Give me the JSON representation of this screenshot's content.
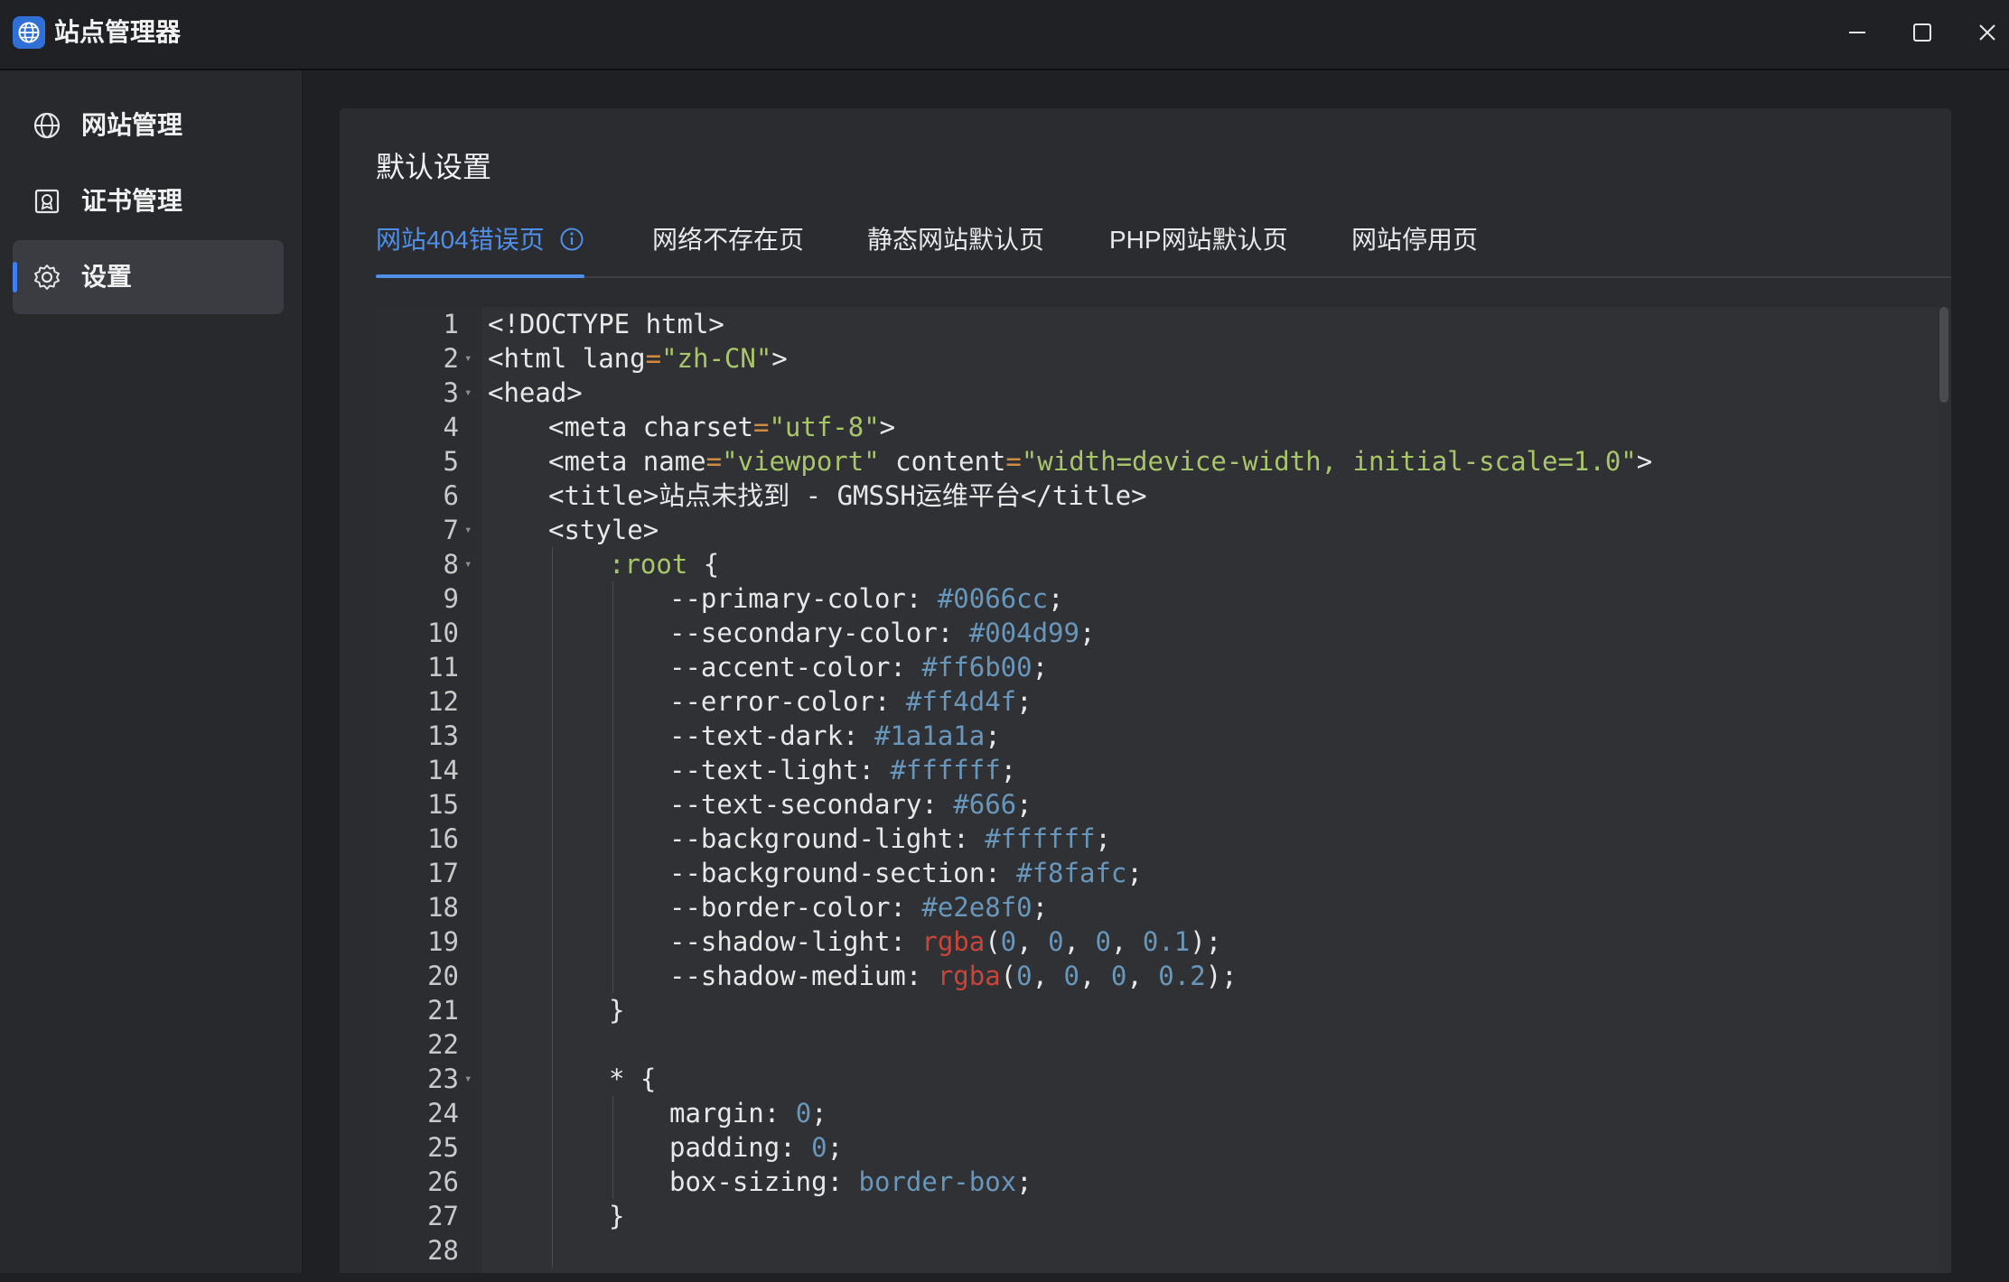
{
  "app": {
    "title": "站点管理器"
  },
  "window_controls": [
    "minimize",
    "maximize",
    "close"
  ],
  "sidebar": {
    "items": [
      {
        "label": "网站管理",
        "icon": "globe-icon",
        "active": false
      },
      {
        "label": "证书管理",
        "icon": "certificate-icon",
        "active": false
      },
      {
        "label": "设置",
        "icon": "gear-icon",
        "active": true
      }
    ]
  },
  "main": {
    "section_title": "默认设置",
    "tabs": [
      {
        "label": "网站404错误页",
        "active": true,
        "has_info_icon": true
      },
      {
        "label": "网络不存在页",
        "active": false
      },
      {
        "label": "静态网站默认页",
        "active": false
      },
      {
        "label": "PHP网站默认页",
        "active": false
      },
      {
        "label": "网站停用页",
        "active": false
      }
    ]
  },
  "colors": {
    "accent": "#4f8fe8",
    "string": "#a9c56a",
    "number": "#6897bb",
    "function": "#c8453a",
    "operator": "#cf8b3f"
  },
  "editor": {
    "lines": [
      {
        "n": "1",
        "fold": false,
        "indent": 0,
        "tokens": [
          [
            "tag",
            "<!DOCTYPE html>"
          ]
        ]
      },
      {
        "n": "2",
        "fold": true,
        "indent": 0,
        "tokens": [
          [
            "tag",
            "<html "
          ],
          [
            "attr",
            "lang"
          ],
          [
            "eq",
            "="
          ],
          [
            "str",
            "\"zh-CN\""
          ],
          [
            "tag",
            ">"
          ]
        ]
      },
      {
        "n": "3",
        "fold": true,
        "indent": 0,
        "tokens": [
          [
            "tag",
            "<head>"
          ]
        ]
      },
      {
        "n": "4",
        "fold": false,
        "indent": 1,
        "tokens": [
          [
            "tag",
            "<meta "
          ],
          [
            "attr",
            "charset"
          ],
          [
            "eq",
            "="
          ],
          [
            "str",
            "\"utf-8\""
          ],
          [
            "tag",
            ">"
          ]
        ]
      },
      {
        "n": "5",
        "fold": false,
        "indent": 1,
        "tokens": [
          [
            "tag",
            "<meta "
          ],
          [
            "attr",
            "name"
          ],
          [
            "eq",
            "="
          ],
          [
            "str",
            "\"viewport\""
          ],
          [
            "attr",
            " content"
          ],
          [
            "eq",
            "="
          ],
          [
            "str",
            "\"width=device-width, initial-scale=1.0\""
          ],
          [
            "tag",
            ">"
          ]
        ]
      },
      {
        "n": "6",
        "fold": false,
        "indent": 1,
        "tokens": [
          [
            "tag",
            "<title>"
          ],
          [
            "attr",
            "站点未找到 - GMSSH运维平台"
          ],
          [
            "tag",
            "</title>"
          ]
        ]
      },
      {
        "n": "7",
        "fold": true,
        "indent": 1,
        "tokens": [
          [
            "tag",
            "<style>"
          ]
        ]
      },
      {
        "n": "8",
        "fold": true,
        "indent": 2,
        "tokens": [
          [
            "sel",
            ":root"
          ],
          [
            "attr",
            " {"
          ]
        ]
      },
      {
        "n": "9",
        "fold": false,
        "indent": 3,
        "tokens": [
          [
            "attr",
            "--primary-color: "
          ],
          [
            "num",
            "#0066cc"
          ],
          [
            "attr",
            ";"
          ]
        ]
      },
      {
        "n": "10",
        "fold": false,
        "indent": 3,
        "tokens": [
          [
            "attr",
            "--secondary-color: "
          ],
          [
            "num",
            "#004d99"
          ],
          [
            "attr",
            ";"
          ]
        ]
      },
      {
        "n": "11",
        "fold": false,
        "indent": 3,
        "tokens": [
          [
            "attr",
            "--accent-color: "
          ],
          [
            "num",
            "#ff6b00"
          ],
          [
            "attr",
            ";"
          ]
        ]
      },
      {
        "n": "12",
        "fold": false,
        "indent": 3,
        "tokens": [
          [
            "attr",
            "--error-color: "
          ],
          [
            "num",
            "#ff4d4f"
          ],
          [
            "attr",
            ";"
          ]
        ]
      },
      {
        "n": "13",
        "fold": false,
        "indent": 3,
        "tokens": [
          [
            "attr",
            "--text-dark: "
          ],
          [
            "num",
            "#1a1a1a"
          ],
          [
            "attr",
            ";"
          ]
        ]
      },
      {
        "n": "14",
        "fold": false,
        "indent": 3,
        "tokens": [
          [
            "attr",
            "--text-light: "
          ],
          [
            "num",
            "#ffffff"
          ],
          [
            "attr",
            ";"
          ]
        ]
      },
      {
        "n": "15",
        "fold": false,
        "indent": 3,
        "tokens": [
          [
            "attr",
            "--text-secondary: "
          ],
          [
            "num",
            "#666"
          ],
          [
            "attr",
            ";"
          ]
        ]
      },
      {
        "n": "16",
        "fold": false,
        "indent": 3,
        "tokens": [
          [
            "attr",
            "--background-light: "
          ],
          [
            "num",
            "#ffffff"
          ],
          [
            "attr",
            ";"
          ]
        ]
      },
      {
        "n": "17",
        "fold": false,
        "indent": 3,
        "tokens": [
          [
            "attr",
            "--background-section: "
          ],
          [
            "num",
            "#f8fafc"
          ],
          [
            "attr",
            ";"
          ]
        ]
      },
      {
        "n": "18",
        "fold": false,
        "indent": 3,
        "tokens": [
          [
            "attr",
            "--border-color: "
          ],
          [
            "num",
            "#e2e8f0"
          ],
          [
            "attr",
            ";"
          ]
        ]
      },
      {
        "n": "19",
        "fold": false,
        "indent": 3,
        "tokens": [
          [
            "attr",
            "--shadow-light: "
          ],
          [
            "fn",
            "rgba"
          ],
          [
            "attr",
            "("
          ],
          [
            "num",
            "0"
          ],
          [
            "attr",
            ", "
          ],
          [
            "num",
            "0"
          ],
          [
            "attr",
            ", "
          ],
          [
            "num",
            "0"
          ],
          [
            "attr",
            ", "
          ],
          [
            "num",
            "0.1"
          ],
          [
            "attr",
            ");"
          ]
        ]
      },
      {
        "n": "20",
        "fold": false,
        "indent": 3,
        "tokens": [
          [
            "attr",
            "--shadow-medium: "
          ],
          [
            "fn",
            "rgba"
          ],
          [
            "attr",
            "("
          ],
          [
            "num",
            "0"
          ],
          [
            "attr",
            ", "
          ],
          [
            "num",
            "0"
          ],
          [
            "attr",
            ", "
          ],
          [
            "num",
            "0"
          ],
          [
            "attr",
            ", "
          ],
          [
            "num",
            "0.2"
          ],
          [
            "attr",
            ");"
          ]
        ]
      },
      {
        "n": "21",
        "fold": false,
        "indent": 2,
        "tokens": [
          [
            "attr",
            "}"
          ]
        ]
      },
      {
        "n": "22",
        "fold": false,
        "indent": 0,
        "tokens": []
      },
      {
        "n": "23",
        "fold": true,
        "indent": 2,
        "tokens": [
          [
            "attr",
            "* {"
          ]
        ]
      },
      {
        "n": "24",
        "fold": false,
        "indent": 3,
        "tokens": [
          [
            "attr",
            "margin: "
          ],
          [
            "num",
            "0"
          ],
          [
            "attr",
            ";"
          ]
        ]
      },
      {
        "n": "25",
        "fold": false,
        "indent": 3,
        "tokens": [
          [
            "attr",
            "padding: "
          ],
          [
            "num",
            "0"
          ],
          [
            "attr",
            ";"
          ]
        ]
      },
      {
        "n": "26",
        "fold": false,
        "indent": 3,
        "tokens": [
          [
            "attr",
            "box-sizing: "
          ],
          [
            "kw",
            "border-box"
          ],
          [
            "attr",
            ";"
          ]
        ]
      },
      {
        "n": "27",
        "fold": false,
        "indent": 2,
        "tokens": [
          [
            "attr",
            "}"
          ]
        ]
      },
      {
        "n": "28",
        "fold": false,
        "indent": 0,
        "tokens": []
      }
    ]
  }
}
